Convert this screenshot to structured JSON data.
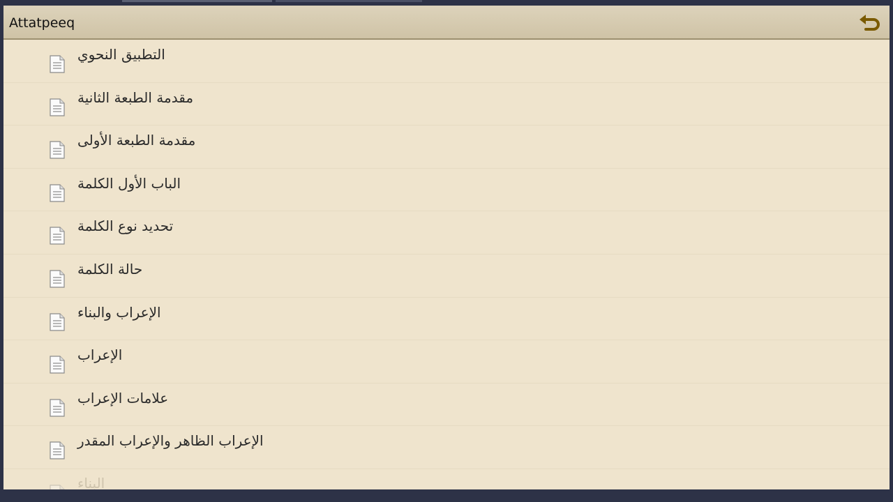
{
  "app": {
    "title": "Attatpeeq",
    "back_icon": "back-arrow-icon",
    "accent_color": "#7a5a00"
  },
  "list": {
    "item_icon": "document-icon",
    "items": [
      {
        "label": "التطبيق النحوي"
      },
      {
        "label": "مقدمة الطبعة الثانية"
      },
      {
        "label": "مقدمة الطبعة الأولى"
      },
      {
        "label": "الباب الأول الكلمة"
      },
      {
        "label": "تحديد نوع الكلمة"
      },
      {
        "label": "حالة الكلمة"
      },
      {
        "label": "الإعراب والبناء"
      },
      {
        "label": "الإعراب"
      },
      {
        "label": "علامات الإعراب"
      },
      {
        "label": "الإعراب الظاهر والإعراب المقدر"
      },
      {
        "label": "البناء"
      }
    ]
  }
}
